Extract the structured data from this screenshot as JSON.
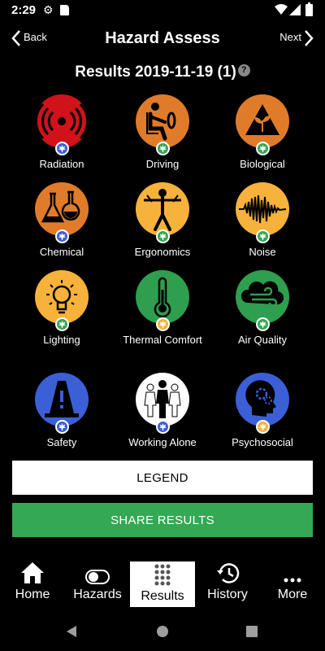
{
  "status_bar": {
    "time": "2:29"
  },
  "header": {
    "back_label": "Back",
    "title": "Hazard Assess",
    "next_label": "Next"
  },
  "results": {
    "title": "Results 2019-11-19 (1)",
    "help_glyph": "?"
  },
  "hazards": [
    {
      "label": "Radiation",
      "icon": "radiation-icon",
      "color": "#d0121b",
      "badge_color": "#3b5fd6"
    },
    {
      "label": "Driving",
      "icon": "driving-icon",
      "color": "#e07b2a",
      "badge_color": "#34a853"
    },
    {
      "label": "Biological",
      "icon": "biological-icon",
      "color": "#e07b2a",
      "badge_color": "#34a853"
    },
    {
      "label": "Chemical",
      "icon": "chemical-icon",
      "color": "#e07b2a",
      "badge_color": "#3b5fd6"
    },
    {
      "label": "Ergonomics",
      "icon": "ergonomics-icon",
      "color": "#f6b23a",
      "badge_color": "#34a853"
    },
    {
      "label": "Noise",
      "icon": "noise-icon",
      "color": "#f6b23a",
      "badge_color": "#34a853"
    },
    {
      "label": "Lighting",
      "icon": "lighting-icon",
      "color": "#f6b23a",
      "badge_color": "#34a853"
    },
    {
      "label": "Thermal Comfort",
      "icon": "thermometer-icon",
      "color": "#2e9e4f",
      "badge_color": "#f6b23a"
    },
    {
      "label": "Air Quality",
      "icon": "air-quality-icon",
      "color": "#2e9e4f",
      "badge_color": "#34a853"
    },
    {
      "label": "Safety",
      "icon": "safety-cone-icon",
      "color": "#3b5fd6",
      "badge_color": "#3b5fd6"
    },
    {
      "label": "Working Alone",
      "icon": "working-alone-icon",
      "color": "#ffffff",
      "badge_color": "#3b5fd6"
    },
    {
      "label": "Psychosocial",
      "icon": "psychosocial-icon",
      "color": "#3b5fd6",
      "badge_color": "#f6b23a"
    }
  ],
  "buttons": {
    "legend": "LEGEND",
    "share": "SHARE RESULTS"
  },
  "tabs": [
    {
      "label": "Home",
      "icon": "home-icon"
    },
    {
      "label": "Hazards",
      "icon": "toggle-icon"
    },
    {
      "label": "Results",
      "icon": "grid-dots-icon",
      "active": true
    },
    {
      "label": "History",
      "icon": "history-icon"
    },
    {
      "label": "More",
      "icon": "more-dots-icon"
    }
  ]
}
